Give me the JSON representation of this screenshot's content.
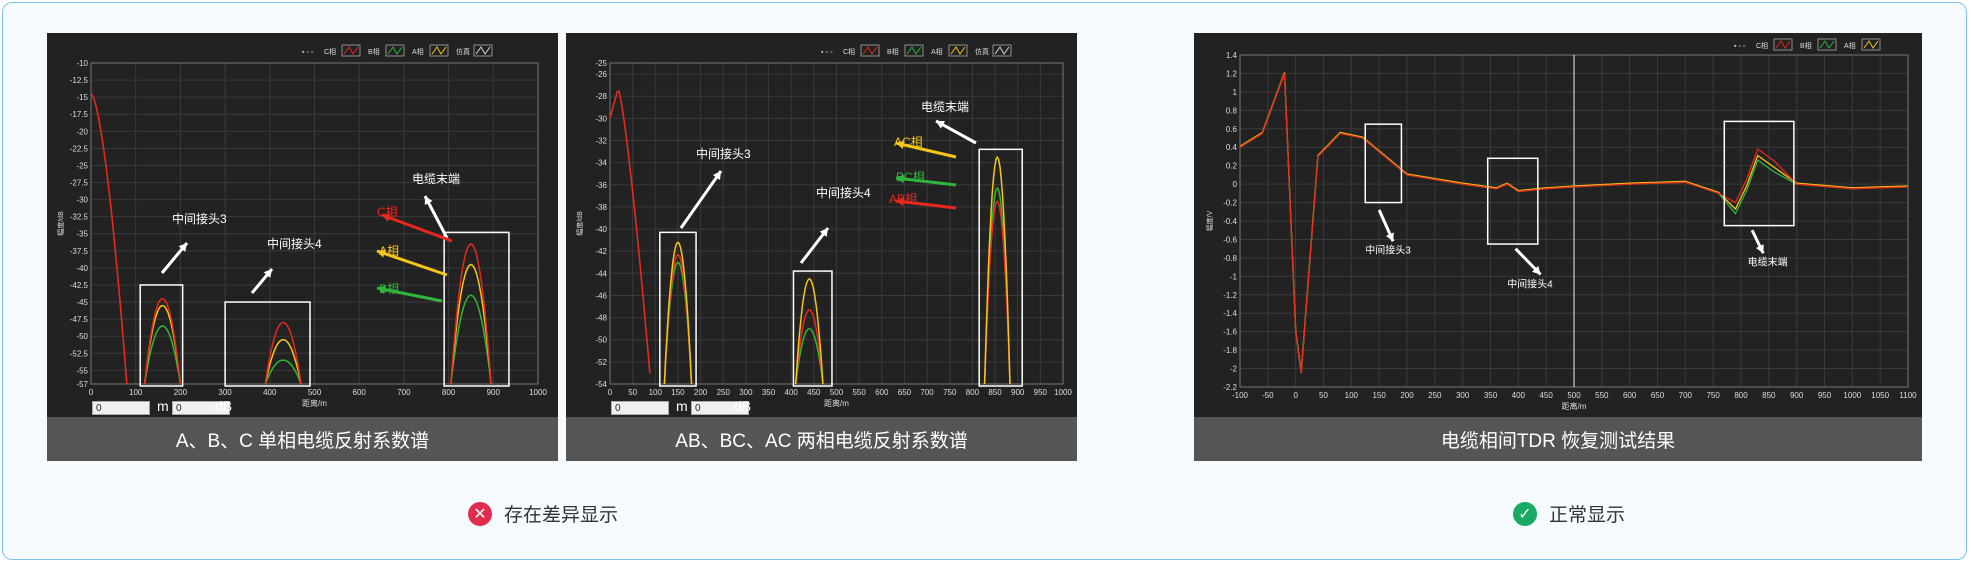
{
  "captions": {
    "c1": "A、B、C 单相电缆反射系数谱",
    "c2": "AB、BC、AC 两相电缆反射系数谱",
    "c3": "电缆相间TDR 恢复测试结果"
  },
  "status": {
    "bad": "存在差异显示",
    "good": "正常显示"
  },
  "icons": {
    "bad": "close-circle-icon",
    "good": "check-circle-icon"
  },
  "colors": {
    "c_phase": "#e8281e",
    "a_phase": "#f5c518",
    "b_phase": "#2fb53a",
    "sim": "#d8d8d8",
    "frame": "#7fc4e8",
    "bad": "#e02d4e",
    "good": "#1aaa63"
  },
  "inputs": {
    "value": "0",
    "unit_m": "m",
    "unit_db": "dB"
  },
  "chart_data": [
    {
      "type": "line",
      "legend": [
        "C相",
        "B相",
        "A相",
        "仿真"
      ],
      "xlabel": "距离/m",
      "ylabel": "幅度/dB",
      "xlim": [
        0,
        1000
      ],
      "ylim": [
        -57,
        -10
      ],
      "xticks": [
        0,
        100,
        200,
        300,
        400,
        500,
        600,
        700,
        800,
        900,
        1000
      ],
      "yticks": [
        -10,
        -12.5,
        -15,
        -17.5,
        -20,
        -22.5,
        -25,
        -27.5,
        -30,
        -32.5,
        -35,
        -37.5,
        -40,
        -42.5,
        -45,
        -47.5,
        -50,
        -52.5,
        -55,
        -57
      ],
      "peaks": [
        {
          "x": 160,
          "C": -44.5,
          "A": -45.5,
          "B": -48.5
        },
        {
          "x": 430,
          "C": -48,
          "A": -50.5,
          "B": -53.5
        },
        {
          "x": 850,
          "C": -36.5,
          "A": -39.5,
          "B": -44
        }
      ],
      "annotations": [
        "中间接头3",
        "中间接头4",
        "电缆末端",
        "C相",
        "A相",
        "B相"
      ]
    },
    {
      "type": "line",
      "legend": [
        "C相",
        "B相",
        "A相",
        "仿真"
      ],
      "xlabel": "距离/m",
      "ylabel": "幅度/dB",
      "xlim": [
        0,
        1000
      ],
      "ylim": [
        -54,
        -25
      ],
      "xticks": [
        0,
        50,
        100,
        150,
        200,
        250,
        300,
        350,
        400,
        450,
        500,
        550,
        600,
        650,
        700,
        750,
        800,
        850,
        900,
        950,
        1000
      ],
      "yticks": [
        -25,
        -26,
        -28,
        -30,
        -32,
        -34,
        -36,
        -38,
        -40,
        -42,
        -44,
        -46,
        -48,
        -50,
        -52,
        -54
      ],
      "peaks": [
        {
          "x": 150,
          "AC": -41.2,
          "AB": -42.3,
          "BC": -43
        },
        {
          "x": 440,
          "AC": -44.5,
          "AB": -47.3,
          "BC": -49
        },
        {
          "x": 855,
          "AC": -33.5,
          "AB": -37.5,
          "BC": -36.3
        }
      ],
      "annotations": [
        "中间接头3",
        "中间接头4",
        "电缆末端",
        "AC相",
        "BC相",
        "AB相"
      ]
    },
    {
      "type": "line",
      "legend": [
        "C相",
        "B相",
        "A相"
      ],
      "xlabel": "距离/m",
      "ylabel": "幅度/V",
      "xlim": [
        -100,
        1100
      ],
      "ylim": [
        -2.2,
        1.4
      ],
      "xticks": [
        -100,
        -50,
        0,
        50,
        100,
        150,
        200,
        250,
        300,
        350,
        400,
        450,
        500,
        550,
        600,
        650,
        700,
        750,
        800,
        850,
        900,
        950,
        1000,
        1050,
        1100
      ],
      "yticks": [
        1.4,
        1.2,
        1,
        0.8,
        0.6,
        0.4,
        0.2,
        0,
        -0.2,
        -0.4,
        -0.6,
        -0.8,
        -1,
        -1.2,
        -1.4,
        -1.6,
        -1.8,
        -2,
        -2.2
      ],
      "cursor_x": 500,
      "key_points": {
        "x": [
          -100,
          -60,
          -20,
          0,
          10,
          40,
          80,
          120,
          150,
          200,
          300,
          360,
          380,
          400,
          450,
          500,
          600,
          700,
          760,
          790,
          810,
          830,
          860,
          900,
          1000,
          1100
        ],
        "y": [
          0.4,
          0.55,
          1.2,
          -1.6,
          -2.05,
          0.3,
          0.55,
          0.5,
          0.35,
          0.1,
          0,
          -0.05,
          0,
          -0.08,
          -0.05,
          -0.03,
          0.0,
          0.02,
          -0.1,
          -0.2,
          0.05,
          0.38,
          0.25,
          0.0,
          -0.05,
          -0.03
        ]
      },
      "annotations": [
        "中间接头3",
        "中间接头4",
        "电缆末端"
      ]
    }
  ]
}
